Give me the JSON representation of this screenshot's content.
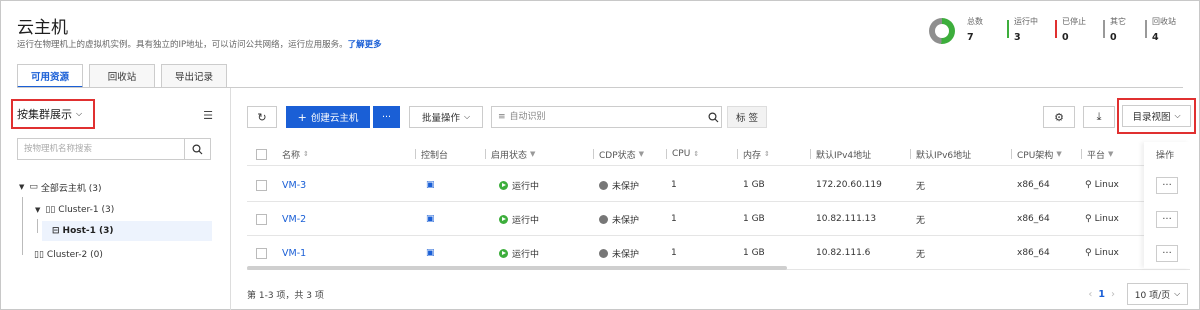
{
  "header": {
    "title": "云主机",
    "subtitle": "运行在物理机上的虚拟机实例。具有独立的IP地址，可以访问公共网络，运行应用服务。",
    "learn_more": "了解更多"
  },
  "stats": {
    "total": {
      "label": "总数",
      "value": "7"
    },
    "running": {
      "label": "运行中",
      "value": "3",
      "color": "#3dae3c"
    },
    "stopped": {
      "label": "已停止",
      "value": "0",
      "color": "#e03030"
    },
    "other": {
      "label": "其它",
      "value": "0",
      "color": "#999999"
    },
    "recycle": {
      "label": "回收站",
      "value": "4",
      "color": "#999999"
    },
    "donut_colors": {
      "running": "#3dae3c",
      "rest": "#8f8f8f"
    }
  },
  "tabs": [
    {
      "label": "可用资源",
      "active": true
    },
    {
      "label": "回收站",
      "active": false
    },
    {
      "label": "导出记录",
      "active": false
    }
  ],
  "left_panel": {
    "view_mode": "按集群展示",
    "search_placeholder": "按物理机名称搜索",
    "tree": {
      "root": "全部云主机 (3)",
      "cluster1": "Cluster-1 (3)",
      "host1": "Host-1 (3)",
      "cluster2": "Cluster-2 (0)"
    }
  },
  "toolbar": {
    "refresh_icon": "refresh-icon",
    "create": "创建云主机",
    "more": "···",
    "batch": "批量操作",
    "filter_placeholder": "自动识别",
    "tag": "标 签",
    "catalog_view": "目录视图"
  },
  "table": {
    "columns": [
      "名称",
      "控制台",
      "启用状态",
      "CDP状态",
      "CPU",
      "内存",
      "默认IPv4地址",
      "默认IPv6地址",
      "CPU架构",
      "平台",
      "操作"
    ],
    "rows": [
      {
        "name": "VM-3",
        "status": "运行中",
        "cdp": "未保护",
        "cpu": "1",
        "mem": "1 GB",
        "ipv4": "172.20.60.119",
        "ipv6": "无",
        "arch": "x86_64",
        "platform": "Linux",
        "op": "···"
      },
      {
        "name": "VM-2",
        "status": "运行中",
        "cdp": "未保护",
        "cpu": "1",
        "mem": "1 GB",
        "ipv4": "10.82.111.13",
        "ipv6": "无",
        "arch": "x86_64",
        "platform": "Linux",
        "op": "···"
      },
      {
        "name": "VM-1",
        "status": "运行中",
        "cdp": "未保护",
        "cpu": "1",
        "mem": "1 GB",
        "ipv4": "10.82.111.6",
        "ipv6": "无",
        "arch": "x86_64",
        "platform": "Linux",
        "op": "···"
      }
    ]
  },
  "footer": {
    "count": "第 1-3 项，共 3 项",
    "page": "1",
    "page_size": "10 项/页"
  },
  "colors": {
    "accent": "#1a5fd6",
    "highlight_box": "#e03030"
  }
}
